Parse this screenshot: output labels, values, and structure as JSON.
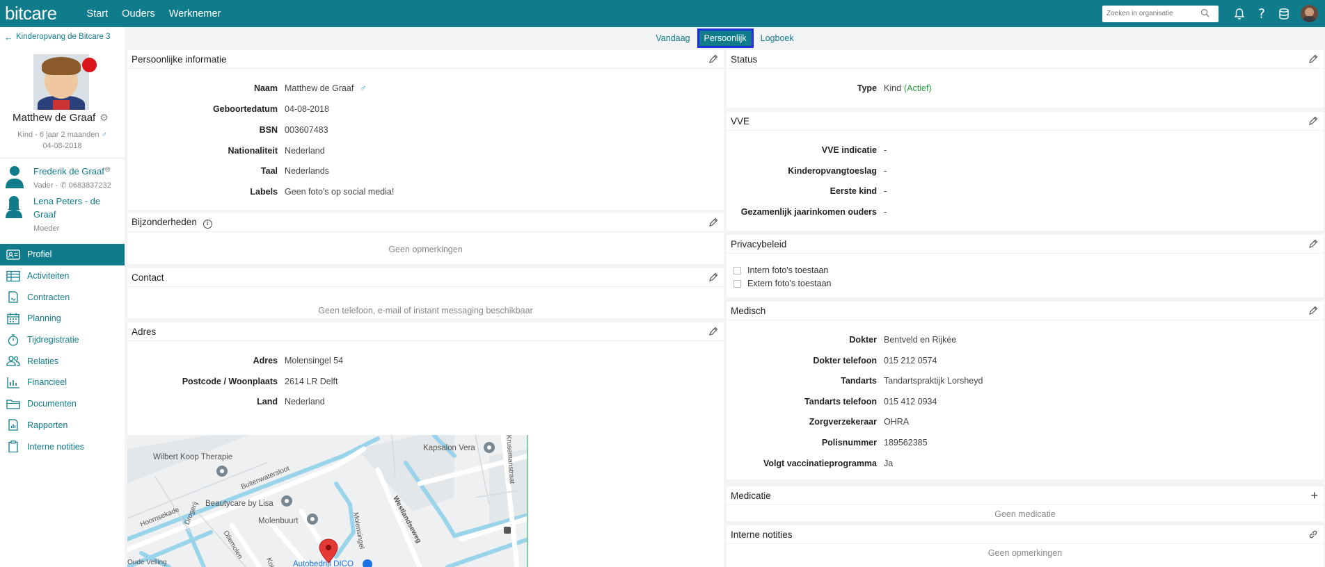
{
  "app": {
    "logo": "bitcare",
    "nav": [
      "Start",
      "Ouders",
      "Werknemer"
    ],
    "search_placeholder": "Zoeken in organisatie"
  },
  "sidebar": {
    "back_label": "Kinderopvang de Bitcare 3",
    "child": {
      "name": "Matthew de Graaf",
      "subtitle": "Kind - 6 jaar 2 maanden",
      "birthdate": "04-08-2018",
      "gender_symbol": "♂"
    },
    "parents": [
      {
        "name": "Frederik de Graaf",
        "role": "Vader - ",
        "phone": "0683837232"
      },
      {
        "name_line1": "Lena Peters - de",
        "name_line2": "Graaf",
        "role": "Moeder"
      }
    ],
    "menu": [
      {
        "label": "Profiel",
        "icon": "profile-card-icon",
        "active": true
      },
      {
        "label": "Activiteiten",
        "icon": "table-icon"
      },
      {
        "label": "Contracten",
        "icon": "contract-icon"
      },
      {
        "label": "Planning",
        "icon": "calendar-icon"
      },
      {
        "label": "Tijdregistratie",
        "icon": "stopwatch-icon"
      },
      {
        "label": "Relaties",
        "icon": "people-icon"
      },
      {
        "label": "Financieel",
        "icon": "bar-chart-icon"
      },
      {
        "label": "Documenten",
        "icon": "folder-icon"
      },
      {
        "label": "Rapporten",
        "icon": "report-icon"
      },
      {
        "label": "Interne notities",
        "icon": "clipboard-icon"
      }
    ]
  },
  "tabs": [
    {
      "label": "Vandaag"
    },
    {
      "label": "Persoonlijk",
      "active": true
    },
    {
      "label": "Logboek"
    }
  ],
  "personal": {
    "title": "Persoonlijke informatie",
    "rows": [
      {
        "label": "Naam",
        "value": "Matthew de Graaf"
      },
      {
        "label": "Geboortedatum",
        "value": "04-08-2018"
      },
      {
        "label": "BSN",
        "value": "003607483"
      },
      {
        "label": "Nationaliteit",
        "value": "Nederland"
      },
      {
        "label": "Taal",
        "value": "Nederlands"
      },
      {
        "label": "Labels",
        "value": "Geen foto's op social media!"
      }
    ]
  },
  "bijzonderheden": {
    "title": "Bijzonderheden",
    "empty": "Geen opmerkingen"
  },
  "contact": {
    "title": "Contact",
    "empty": "Geen telefoon, e-mail of instant messaging beschikbaar"
  },
  "adres": {
    "title": "Adres",
    "rows": [
      {
        "label": "Adres",
        "value": "Molensingel 54"
      },
      {
        "label": "Postcode / Woonplaats",
        "value": "2614 LR Delft"
      },
      {
        "label": "Land",
        "value": "Nederland"
      }
    ],
    "map_labels": {
      "wilbert": "Wilbert Koop Therapie",
      "buitenwatersloot": "Buitenwatersloot",
      "kapsalon": "Kapsalon Vera",
      "krusemanstraat": "Krusemanstraat",
      "westlandseweg": "Westlandseweg",
      "beautycare": "Beautycare by Lisa",
      "hoornsekade": "Hoornsekade",
      "molenbuurt": "Molenbuurt",
      "drogerij": "Drogerij",
      "oliemolen": "Oliemolen",
      "molensingel": "Molensingel",
      "oude_velling": "Oude Velling",
      "kol": "Kol",
      "autobedrijf": "Autobedrijf DICO"
    }
  },
  "status": {
    "title": "Status",
    "type_label": "Type",
    "type_value": "Kind",
    "type_state": "(Actief)"
  },
  "vve": {
    "title": "VVE",
    "rows": [
      {
        "label": "VVE indicatie",
        "value": "-"
      },
      {
        "label": "Kinderopvangtoeslag",
        "value": "-"
      },
      {
        "label": "Eerste kind",
        "value": "-"
      },
      {
        "label": "Gezamenlijk jaarinkomen ouders",
        "value": "-"
      }
    ]
  },
  "privacy": {
    "title": "Privacybeleid",
    "options": [
      "Intern foto's toestaan",
      "Extern foto's toestaan"
    ]
  },
  "medisch": {
    "title": "Medisch",
    "rows": [
      {
        "label": "Dokter",
        "value": "Bentveld en Rijkée"
      },
      {
        "label": "Dokter telefoon",
        "value": "015 212 0574"
      },
      {
        "label": "Tandarts",
        "value": "Tandartspraktijk Lorsheyd"
      },
      {
        "label": "Tandarts telefoon",
        "value": "015 412 0934"
      },
      {
        "label": "Zorgverzekeraar",
        "value": "OHRA"
      },
      {
        "label": "Polisnummer",
        "value": "189562385"
      },
      {
        "label": "Volgt vaccinatieprogramma",
        "value": "Ja"
      }
    ]
  },
  "medicatie": {
    "title": "Medicatie",
    "empty": "Geen medicatie"
  },
  "interne_notities": {
    "title": "Interne notities",
    "empty": "Geen opmerkingen"
  },
  "colors": {
    "brand": "#0f7b8b",
    "active_status": "#2a9d3c",
    "alert": "#d9141a"
  }
}
